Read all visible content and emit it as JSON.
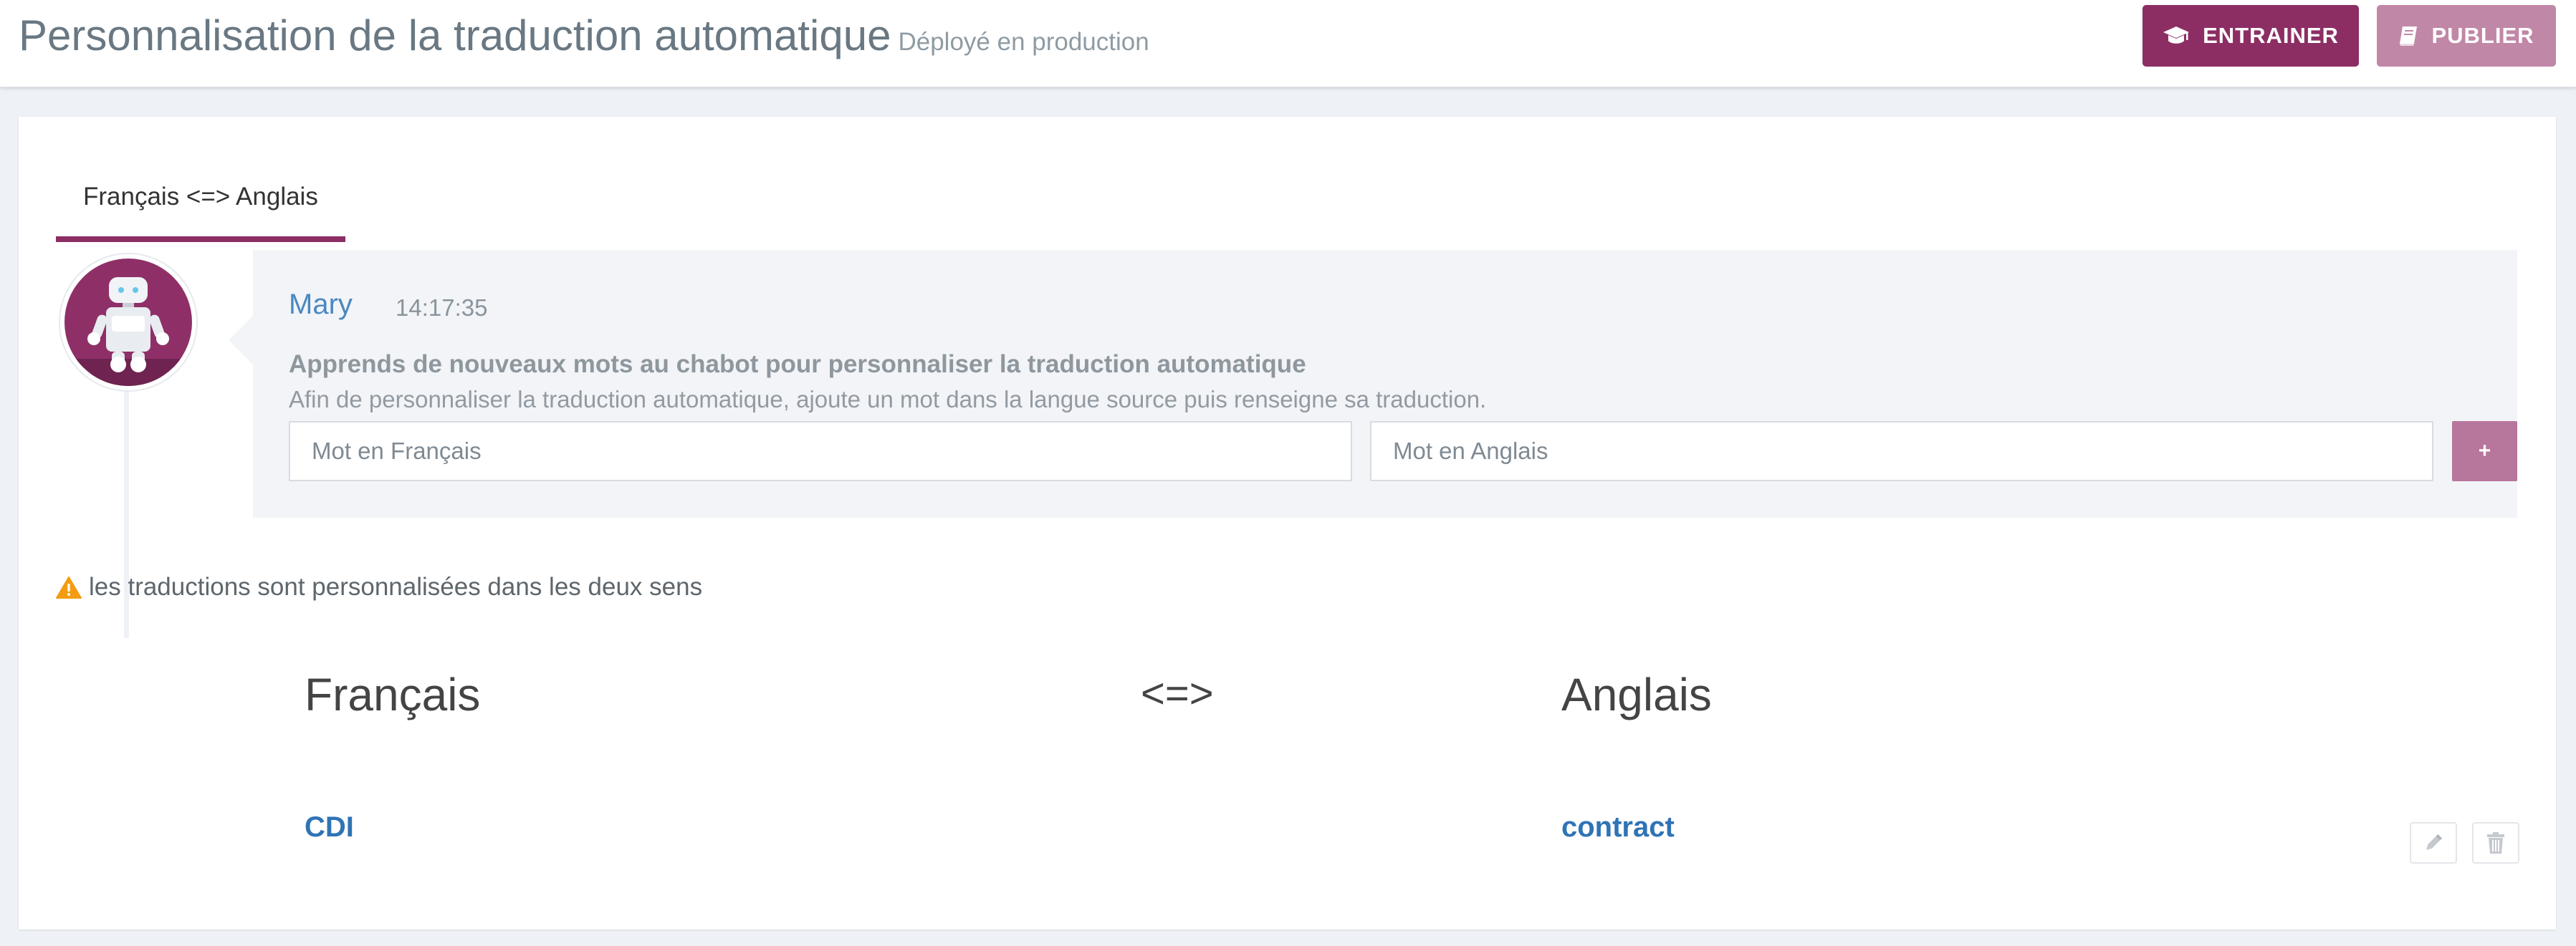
{
  "header": {
    "title": "Personnalisation de la traduction automatique",
    "subtitle": "Déployé en production",
    "train_label": "ENTRAINER",
    "publish_label": "PUBLIER"
  },
  "tabs": [
    {
      "label": "Français <=> Anglais",
      "active": true
    }
  ],
  "message": {
    "author": "Mary",
    "time": "14:17:35",
    "heading": "Apprends de nouveaux mots au chabot pour personnaliser la traduction automatique",
    "body": "Afin de personnaliser la traduction automatique, ajoute un mot dans la langue source puis renseigne sa traduction.",
    "source_placeholder": "Mot en Français",
    "target_placeholder": "Mot en Anglais",
    "add_label": "+"
  },
  "warning": {
    "text": "les traductions sont personnalisées dans les deux sens"
  },
  "table": {
    "headers": [
      "Français",
      "<=>",
      "Anglais"
    ],
    "rows": [
      {
        "source": "CDI",
        "target": "contract"
      }
    ]
  },
  "colors": {
    "primary": "#8c2e64",
    "primary_light": "#c187a7",
    "link": "#2f74b5",
    "warning": "#f39c12"
  },
  "icons": {
    "train": "graduation-cap-icon",
    "publish": "book-icon",
    "warning": "warning-triangle-icon",
    "edit": "pencil-icon",
    "delete": "trash-icon",
    "avatar": "robot-avatar-icon"
  }
}
